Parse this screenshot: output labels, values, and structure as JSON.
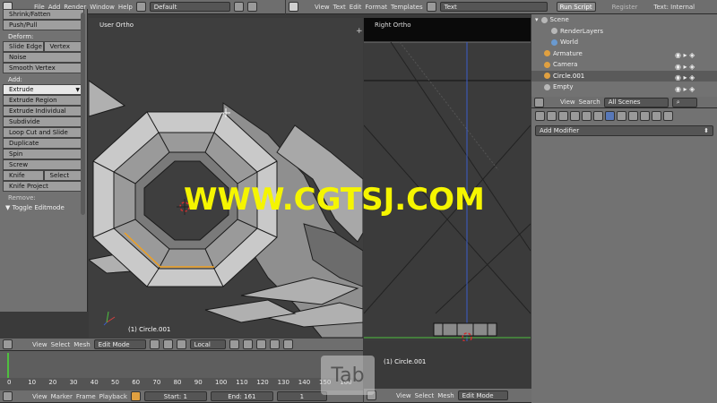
{
  "top_header_left": {
    "menus": [
      "File",
      "Add",
      "Render",
      "Window",
      "Help"
    ],
    "layout_select": "Default"
  },
  "text_editor_header": {
    "menus": [
      "View",
      "Text",
      "Edit",
      "Format",
      "Templates"
    ],
    "text_select": "Text",
    "run_script": "Run Script",
    "register": "Register",
    "text_internal": "Text: Internal"
  },
  "toolshelf": {
    "top_buttons": [
      "Shrink/Fatten",
      "Push/Pull"
    ],
    "deform_label": "Deform:",
    "deform_row": [
      "Slide Edge",
      "Vertex"
    ],
    "deform_buttons": [
      "Noise",
      "Smooth Vertex"
    ],
    "add_label": "Add:",
    "add_buttons": [
      "Extrude",
      "Extrude Region",
      "Extrude Individual",
      "Subdivide",
      "Loop Cut and Slide",
      "Duplicate",
      "Spin",
      "Screw"
    ],
    "knife_row": [
      "Knife",
      "Select"
    ],
    "knife_project": "Knife Project",
    "remove_label": "Remove:",
    "toggle": "Toggle Editmode"
  },
  "viewport_left": {
    "label": "User Ortho",
    "object_label": "(1) Circle.001"
  },
  "viewport_right": {
    "label": "Right Ortho",
    "object_label": "(1) Circle.001"
  },
  "outliner": {
    "items": [
      "Scene",
      "RenderLayers",
      "World",
      "Armature",
      "Camera",
      "Circle.001",
      "Empty"
    ],
    "view": "View",
    "search": "Search",
    "scenes": "All Scenes"
  },
  "properties": {
    "add_modifier": "Add Modifier"
  },
  "view3d_header": {
    "menus": [
      "View",
      "Select",
      "Mesh"
    ],
    "mode": "Edit Mode",
    "orientation": "Local"
  },
  "right_header": {
    "menus": [
      "View",
      "Select",
      "Mesh"
    ],
    "mode": "Edit Mode"
  },
  "timeline": {
    "ticks": [
      "0",
      "10",
      "20",
      "30",
      "40",
      "50",
      "60",
      "70",
      "80",
      "90",
      "100",
      "110",
      "120",
      "130",
      "140",
      "150",
      "160"
    ],
    "menus": [
      "View",
      "Marker",
      "Frame",
      "Playback"
    ],
    "start": "Start: 1",
    "end": "End: 161",
    "current": "1"
  },
  "watermark": "WWW.CGTSJ.COM",
  "key_overlay": "Tab",
  "colors": {
    "watermark": "#f5f500",
    "header_bg": "#6e6e6e",
    "panel_bg": "#727272",
    "viewport_bg": "#3e3e3e",
    "active_button": "#e8e8e8",
    "axis_blue": "#3b5cc8",
    "axis_green": "#4fbf3f"
  }
}
